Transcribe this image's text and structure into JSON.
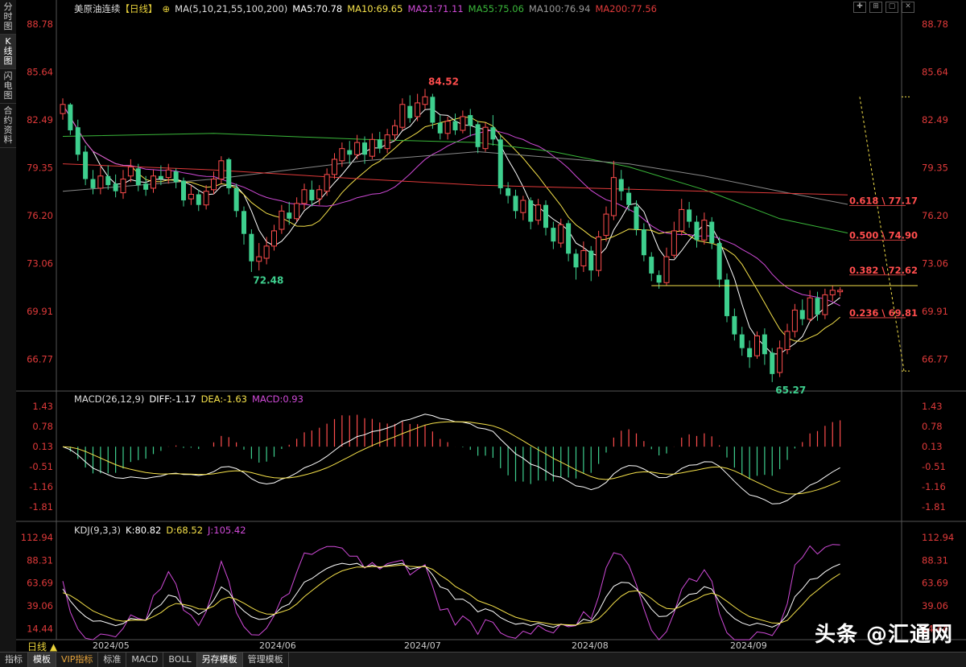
{
  "sidebar": {
    "tabs": [
      {
        "label": "分时图",
        "active": false
      },
      {
        "label": "K线图",
        "active": true
      },
      {
        "label": "闪电图",
        "active": false
      },
      {
        "label": "合约资料",
        "active": false
      }
    ]
  },
  "main_legend": {
    "symbol": "美原油连续",
    "period": "【日线】",
    "ma_spec": "MA(5,10,21,55,100,200)",
    "ma5": "MA5:70.78",
    "ma10": "MA10:69.65",
    "ma21": "MA21:71.11",
    "ma55": "MA55:75.06",
    "ma100": "MA100:76.94",
    "ma200": "MA200:77.56"
  },
  "macd_legend": {
    "spec": "MACD(26,12,9)",
    "diff": "DIFF:-1.17",
    "dea": "DEA:-1.63",
    "macd": "MACD:0.93"
  },
  "kdj_legend": {
    "spec": "KDJ(9,3,3)",
    "k": "K:80.82",
    "d": "D:68.52",
    "j": "J:105.42"
  },
  "price_axis": [
    "88.78",
    "85.64",
    "82.49",
    "79.35",
    "76.20",
    "73.06",
    "69.91",
    "66.77"
  ],
  "macd_axis": [
    "1.43",
    "0.78",
    "0.13",
    "-0.51",
    "-1.16",
    "-1.81"
  ],
  "kdj_axis": [
    "112.94",
    "88.31",
    "63.69",
    "39.06",
    "14.44"
  ],
  "date_axis": [
    "2024/05",
    "2024/06",
    "2024/07",
    "2024/08",
    "2024/09"
  ],
  "annotations": {
    "high": "84.52",
    "low1": "72.48",
    "low2": "65.27",
    "fib": [
      "0.618 \\ 77.17",
      "0.500 \\ 74.90",
      "0.382 \\ 72.62",
      "0.236 \\ 69.81"
    ]
  },
  "colors": {
    "up": "#ff4d4d",
    "down": "#3ecf8e",
    "ma5": "#ffffff",
    "ma10": "#f5e14a",
    "ma21": "#d04ad8",
    "ma55": "#3ab83a",
    "ma100": "#888888",
    "ma200": "#e03a3a"
  },
  "bottom_tabs": [
    "指标",
    "模板",
    "VIP指标",
    "标准",
    "MACD",
    "BOLL",
    "另存模板",
    "管理模板"
  ],
  "period_label": "日线 ▲",
  "watermark": "头条 @汇通网",
  "chart_data": {
    "type": "candlestick",
    "ylim": [
      65.0,
      89.3
    ],
    "candles": [
      [
        82.9,
        83.5,
        83.9,
        82.5
      ],
      [
        83.5,
        81.8,
        83.6,
        81.5
      ],
      [
        82.0,
        80.2,
        82.5,
        79.8
      ],
      [
        80.4,
        78.6,
        80.8,
        78.2
      ],
      [
        78.6,
        78.0,
        79.2,
        77.6
      ],
      [
        78.0,
        78.8,
        79.4,
        77.6
      ],
      [
        78.8,
        78.2,
        79.5,
        77.9
      ],
      [
        78.3,
        77.8,
        78.9,
        77.4
      ],
      [
        77.7,
        78.6,
        79.2,
        77.3
      ],
      [
        78.8,
        79.4,
        79.9,
        78.4
      ],
      [
        79.3,
        78.2,
        79.6,
        77.8
      ],
      [
        78.3,
        77.9,
        78.8,
        77.5
      ],
      [
        78.0,
        78.8,
        79.2,
        77.7
      ],
      [
        78.8,
        78.6,
        79.5,
        78.2
      ],
      [
        78.7,
        79.2,
        79.6,
        78.3
      ],
      [
        79.1,
        78.4,
        79.3,
        78.0
      ],
      [
        78.5,
        77.2,
        78.7,
        76.8
      ],
      [
        77.3,
        77.6,
        78.2,
        76.9
      ],
      [
        77.6,
        76.9,
        77.9,
        76.5
      ],
      [
        76.9,
        77.8,
        78.2,
        76.6
      ],
      [
        77.9,
        78.6,
        79.1,
        77.6
      ],
      [
        78.6,
        79.8,
        80.1,
        78.3
      ],
      [
        79.9,
        78.0,
        80.0,
        77.6
      ],
      [
        78.0,
        76.5,
        78.3,
        76.1
      ],
      [
        76.5,
        75.0,
        76.8,
        74.3
      ],
      [
        75.0,
        73.2,
        75.3,
        72.5
      ],
      [
        73.2,
        73.5,
        74.4,
        72.6
      ],
      [
        73.4,
        74.2,
        74.8,
        73.0
      ],
      [
        74.2,
        75.2,
        75.6,
        73.9
      ],
      [
        75.3,
        76.5,
        76.9,
        75.0
      ],
      [
        76.4,
        76.0,
        77.1,
        75.6
      ],
      [
        76.0,
        77.0,
        77.4,
        75.8
      ],
      [
        77.0,
        77.9,
        78.3,
        76.6
      ],
      [
        77.9,
        77.2,
        78.5,
        76.8
      ],
      [
        77.3,
        77.9,
        78.2,
        76.9
      ],
      [
        77.8,
        78.9,
        79.3,
        77.5
      ],
      [
        78.9,
        79.9,
        80.3,
        78.6
      ],
      [
        79.8,
        80.6,
        81.0,
        79.4
      ],
      [
        80.5,
        80.2,
        81.1,
        79.6
      ],
      [
        80.2,
        81.0,
        81.5,
        79.9
      ],
      [
        81.0,
        80.2,
        81.4,
        79.6
      ],
      [
        80.1,
        81.2,
        81.6,
        79.9
      ],
      [
        81.2,
        80.6,
        81.7,
        80.3
      ],
      [
        80.6,
        81.5,
        81.9,
        80.3
      ],
      [
        81.5,
        82.1,
        82.5,
        81.1
      ],
      [
        82.0,
        83.5,
        83.9,
        81.8
      ],
      [
        83.4,
        82.6,
        84.1,
        82.3
      ],
      [
        82.7,
        83.6,
        84.2,
        82.4
      ],
      [
        83.5,
        84.0,
        84.52,
        83.2
      ],
      [
        84.0,
        82.3,
        84.2,
        81.9
      ],
      [
        82.3,
        81.6,
        82.8,
        81.2
      ],
      [
        81.6,
        82.4,
        82.7,
        81.2
      ],
      [
        82.4,
        81.8,
        82.9,
        81.5
      ],
      [
        81.8,
        82.7,
        83.1,
        81.6
      ],
      [
        82.8,
        82.1,
        83.2,
        81.4
      ],
      [
        82.2,
        80.7,
        82.4,
        80.3
      ],
      [
        80.6,
        82.0,
        82.3,
        80.4
      ],
      [
        82.0,
        81.2,
        82.8,
        80.8
      ],
      [
        81.2,
        78.0,
        81.5,
        77.6
      ],
      [
        78.0,
        77.5,
        78.4,
        77.0
      ],
      [
        77.5,
        76.5,
        77.9,
        76.0
      ],
      [
        76.4,
        77.2,
        77.5,
        75.9
      ],
      [
        77.2,
        75.8,
        77.4,
        75.3
      ],
      [
        75.9,
        76.9,
        77.3,
        75.6
      ],
      [
        76.9,
        75.4,
        77.2,
        74.9
      ],
      [
        75.4,
        74.5,
        75.8,
        74.0
      ],
      [
        74.4,
        75.6,
        76.0,
        74.1
      ],
      [
        75.7,
        73.7,
        75.9,
        73.2
      ],
      [
        73.7,
        72.8,
        74.0,
        72.0
      ],
      [
        72.9,
        73.9,
        74.5,
        72.5
      ],
      [
        73.9,
        72.6,
        74.2,
        71.9
      ],
      [
        72.6,
        74.8,
        75.2,
        72.2
      ],
      [
        74.9,
        76.3,
        76.8,
        74.5
      ],
      [
        76.2,
        78.7,
        79.8,
        75.9
      ],
      [
        78.6,
        77.8,
        79.2,
        77.2
      ],
      [
        77.7,
        76.9,
        78.1,
        76.5
      ],
      [
        76.8,
        75.3,
        77.2,
        74.9
      ],
      [
        75.3,
        73.6,
        75.7,
        73.2
      ],
      [
        73.5,
        72.4,
        73.8,
        71.9
      ],
      [
        72.3,
        71.8,
        72.6,
        71.4
      ],
      [
        71.8,
        73.5,
        74.1,
        71.6
      ],
      [
        73.6,
        75.2,
        75.8,
        73.4
      ],
      [
        75.2,
        76.6,
        77.3,
        74.9
      ],
      [
        76.6,
        75.8,
        77.1,
        75.4
      ],
      [
        75.8,
        74.6,
        76.2,
        74.1
      ],
      [
        74.6,
        75.9,
        76.4,
        74.3
      ],
      [
        75.8,
        74.4,
        76.1,
        74.0
      ],
      [
        74.4,
        72.0,
        74.8,
        71.5
      ],
      [
        72.0,
        69.6,
        72.4,
        69.2
      ],
      [
        69.6,
        68.4,
        70.1,
        68.0
      ],
      [
        68.4,
        67.5,
        68.9,
        67.0
      ],
      [
        67.5,
        66.9,
        68.0,
        66.2
      ],
      [
        67.0,
        68.3,
        68.6,
        66.8
      ],
      [
        68.4,
        67.1,
        68.8,
        66.4
      ],
      [
        67.2,
        65.8,
        67.5,
        65.27
      ],
      [
        65.9,
        67.5,
        68.0,
        65.6
      ],
      [
        67.4,
        68.6,
        69.1,
        67.1
      ],
      [
        68.6,
        70.0,
        70.4,
        68.2
      ],
      [
        70.0,
        69.4,
        70.7,
        69.0
      ],
      [
        69.4,
        70.8,
        71.3,
        69.2
      ],
      [
        70.8,
        69.7,
        71.2,
        69.3
      ],
      [
        69.7,
        71.0,
        71.4,
        69.4
      ],
      [
        71.0,
        71.3,
        71.6,
        70.6
      ],
      [
        71.2,
        71.3,
        71.5,
        70.9
      ]
    ],
    "macd_hist_range": [
      -1.81,
      1.43
    ]
  }
}
